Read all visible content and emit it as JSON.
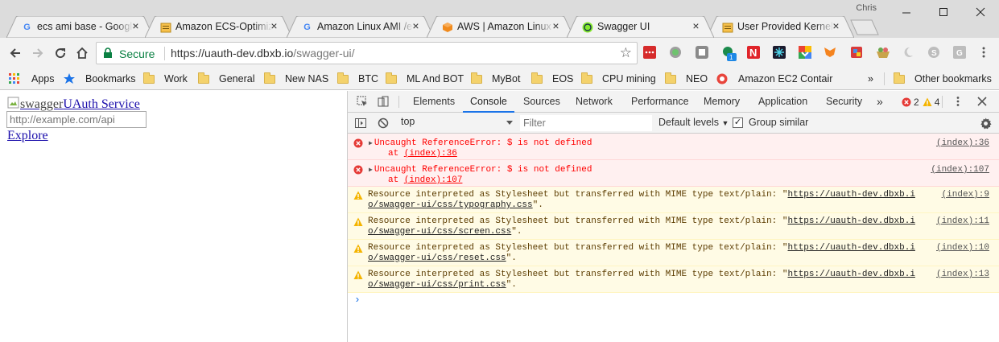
{
  "window": {
    "user_name": "Chris",
    "tabs": [
      {
        "title": "ecs ami base - Google",
        "favicon": "google-g-icon",
        "active": false
      },
      {
        "title": "Amazon ECS-Optimized",
        "favicon": "aws-doc-icon",
        "active": false
      },
      {
        "title": "Amazon Linux AMI /e",
        "favicon": "google-g-icon",
        "active": false
      },
      {
        "title": "AWS | Amazon Linux",
        "favicon": "aws-cube-icon",
        "active": false
      },
      {
        "title": "Swagger UI",
        "favicon": "swagger-icon",
        "active": true
      },
      {
        "title": "User Provided Kernels",
        "favicon": "aws-doc-icon",
        "active": false
      }
    ]
  },
  "toolbar": {
    "secure_label": "Secure",
    "url_host": "https://uauth-dev.dbxb.io",
    "url_path": "/swagger-ui/"
  },
  "bookmarks": {
    "apps_label": "Apps",
    "bookmarks_label": "Bookmarks",
    "items": [
      "Work",
      "General",
      "New NAS",
      "BTC",
      "ML And BOT",
      "MyBot",
      "EOS",
      "CPU mining",
      "NEO"
    ],
    "ec2_label": "Amazon EC2 Contair",
    "overflow": "»",
    "other_label": "Other bookmarks"
  },
  "page": {
    "logo_alt": "swagger",
    "service_title": "UAuth Service",
    "api_placeholder": "http://example.com/api",
    "explore_label": "Explore"
  },
  "devtools": {
    "tabs": [
      "Elements",
      "Console",
      "Sources",
      "Network",
      "Performance",
      "Memory",
      "Application",
      "Security"
    ],
    "active_tab": "Console",
    "more": "»",
    "error_count": "2",
    "warning_count": "4",
    "context": "top",
    "filter_placeholder": "Filter",
    "levels_label": "Default levels",
    "group_similar_label": "Group similar",
    "messages": [
      {
        "level": "error",
        "line1": "Uncaught ReferenceError: $ is not defined",
        "line2_prefix": "at ",
        "line2_link": "(index):36",
        "source": "(index):36"
      },
      {
        "level": "error",
        "line1": "Uncaught ReferenceError: $ is not defined",
        "line2_prefix": "at ",
        "line2_link": "(index):107",
        "source": "(index):107"
      },
      {
        "level": "warn",
        "line1_prefix": "Resource interpreted as Stylesheet but transferred with MIME type text/plain: \"",
        "line1_link": "https://uauth-dev.dbxb.i",
        "line2_link": "o/swagger-ui/css/typography.css",
        "line2_suffix": "\".",
        "source": "(index):9"
      },
      {
        "level": "warn",
        "line1_prefix": "Resource interpreted as Stylesheet but transferred with MIME type text/plain: \"",
        "line1_link": "https://uauth-dev.dbxb.i",
        "line2_link": "o/swagger-ui/css/screen.css",
        "line2_suffix": "\".",
        "source": "(index):11"
      },
      {
        "level": "warn",
        "line1_prefix": "Resource interpreted as Stylesheet but transferred with MIME type text/plain: \"",
        "line1_link": "https://uauth-dev.dbxb.i",
        "line2_link": "o/swagger-ui/css/reset.css",
        "line2_suffix": "\".",
        "source": "(index):10"
      },
      {
        "level": "warn",
        "line1_prefix": "Resource interpreted as Stylesheet but transferred with MIME type text/plain: \"",
        "line1_link": "https://uauth-dev.dbxb.i",
        "line2_link": "o/swagger-ui/css/print.css",
        "line2_suffix": "\".",
        "source": "(index):13"
      }
    ],
    "prompt": "›"
  },
  "colors": {
    "error_bg": "#fff0f0",
    "warn_bg": "#fffbe5",
    "active_tab_underline": "#1a73e8",
    "secure_green": "#0b8043"
  }
}
